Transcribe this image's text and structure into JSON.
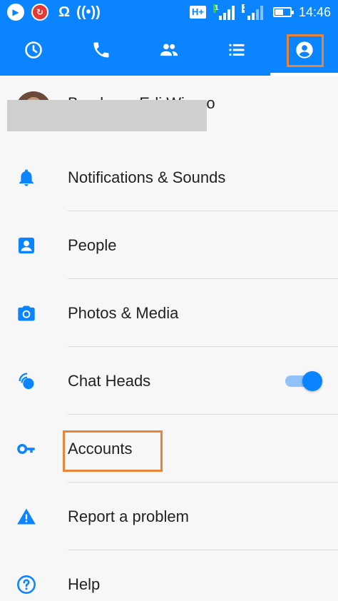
{
  "status_bar": {
    "time": "14:46",
    "network_type": "H+",
    "sim1_label": "1",
    "sim2_label": "2"
  },
  "tabs": [
    {
      "name": "recent",
      "icon": "clock-icon",
      "active": false
    },
    {
      "name": "calls",
      "icon": "phone-icon",
      "active": false
    },
    {
      "name": "groups",
      "icon": "group-icon",
      "active": false
    },
    {
      "name": "people-list",
      "icon": "list-icon",
      "active": false
    },
    {
      "name": "profile",
      "icon": "profile-icon",
      "active": true
    }
  ],
  "profile": {
    "name": "Bambang Edi Wiarso"
  },
  "menu": {
    "notifications": {
      "label": "Notifications & Sounds",
      "icon": "bell-icon"
    },
    "people": {
      "label": "People",
      "icon": "contact-icon"
    },
    "photos": {
      "label": "Photos & Media",
      "icon": "camera-icon"
    },
    "chat_heads": {
      "label": "Chat Heads",
      "icon": "chat-heads-icon",
      "enabled": true
    },
    "accounts": {
      "label": "Accounts",
      "icon": "key-icon"
    },
    "report": {
      "label": "Report a problem",
      "icon": "warning-icon"
    },
    "help": {
      "label": "Help",
      "icon": "help-icon"
    }
  },
  "colors": {
    "brand": "#0a84ff",
    "highlight": "#e8833a"
  }
}
